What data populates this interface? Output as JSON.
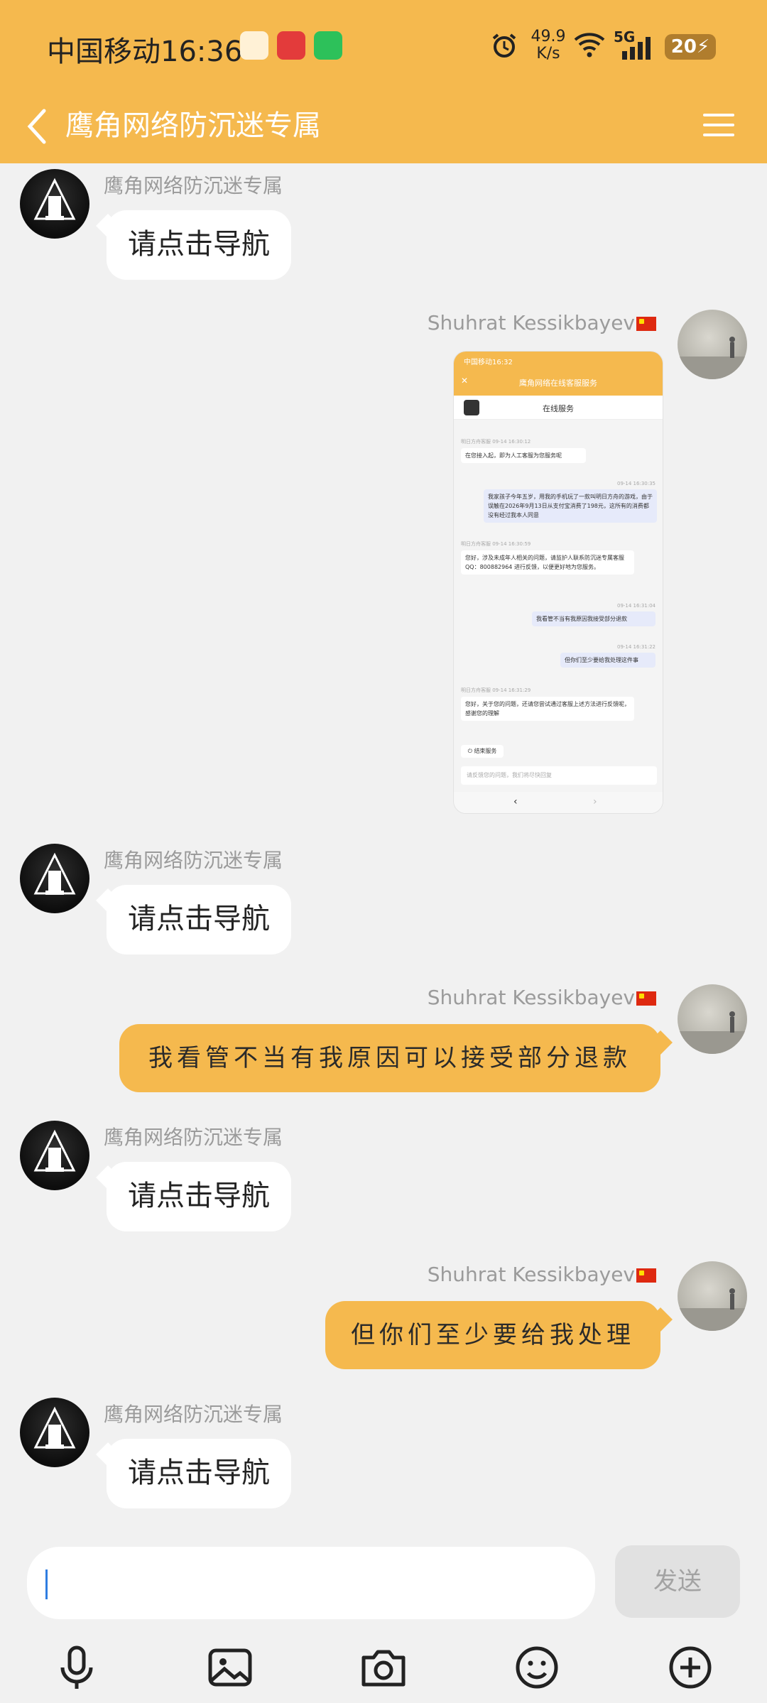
{
  "status_bar": {
    "carrier_time": "中国移动16:36",
    "net_rate_value": "49.9",
    "net_rate_unit": "K/s",
    "network": "5G",
    "battery": "20"
  },
  "header": {
    "title": "鹰角网络防沉迷专属"
  },
  "messages": [
    {
      "sender": "鹰角网络防沉迷专属",
      "text": "请点击导航"
    },
    {
      "sender": "Shuhrat Kessikbayev",
      "image": "chat-screenshot"
    },
    {
      "sender": "鹰角网络防沉迷专属",
      "text": "请点击导航"
    },
    {
      "sender": "Shuhrat Kessikbayev",
      "text": "我看管不当有我原因可以接受部分退款"
    },
    {
      "sender": "鹰角网络防沉迷专属",
      "text": "请点击导航"
    },
    {
      "sender": "Shuhrat Kessikbayev",
      "text": "但你们至少要给我处理"
    },
    {
      "sender": "鹰角网络防沉迷专属",
      "text": "请点击导航"
    }
  ],
  "shot": {
    "status": "中国移动16:32",
    "title": "鹰角网络在线客服服务",
    "service": "在线服务",
    "m1_meta": "明日方舟客服 09-14 16:30:12",
    "m1": "在您接入起，即为人工客服为您服务呢",
    "m2_meta": "09-14 16:30:35",
    "m2": "我家孩子今年五岁，用我的手机玩了一款叫明日方舟的游戏，由于误触在2026年9月13日从支付宝消费了198元，这所有的消费都没有经过我本人同意",
    "m3_meta": "明日方舟客服 09-14 16:30:59",
    "m3": "您好，涉及未成年人相关的问题，请监护人联系防沉迷专属客服QQ：800882964 进行反馈，以便更好地为您服务。",
    "m4_meta": "09-14 16:31:04",
    "m4": "我看管不当有我原因我接受部分退款",
    "m5_meta": "09-14 16:31:22",
    "m5": "但你们至少要给我处理这件事",
    "m6_meta": "明日方舟客服 09-14 16:31:29",
    "m6": "您好，关于您的问题，还请您尝试通过客服上述方法进行反馈呢，感谢您的理解",
    "end_label": "结束服务",
    "input_placeholder": "请反馈您的问题，我们将尽快回复"
  },
  "composer": {
    "send_label": "发送"
  },
  "toolbar_icons": [
    "microphone-icon",
    "image-icon",
    "camera-icon",
    "emoji-icon",
    "plus-icon"
  ],
  "colors": {
    "accent": "#f5b94e",
    "bubble_bot": "#ffffff",
    "background": "#f1f1f1"
  }
}
